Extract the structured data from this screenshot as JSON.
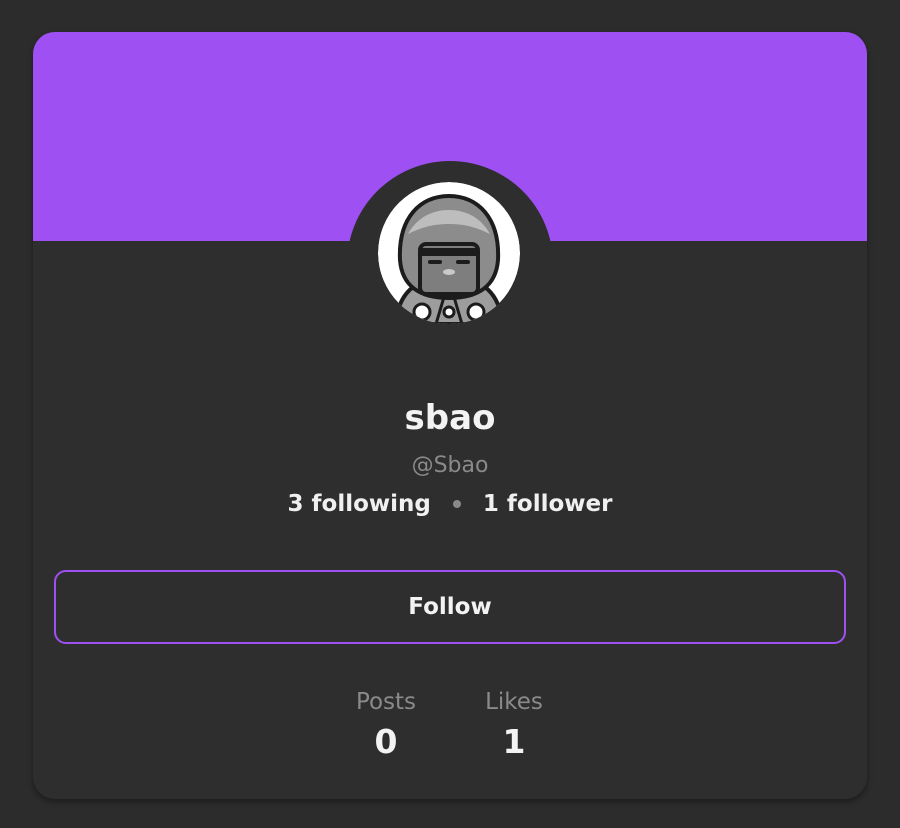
{
  "profile": {
    "display_name": "sbao",
    "handle": "@Sbao",
    "following": "3 following",
    "followers": "1 follower",
    "follow_label": "Follow"
  },
  "counts": [
    {
      "label": "Posts",
      "value": "0"
    },
    {
      "label": "Likes",
      "value": "1"
    }
  ],
  "colors": {
    "accent": "#9e50f2",
    "background": "#2b2c2b",
    "card": "#2d2e2d",
    "text": "#f3f3f3",
    "muted": "#8a8a8a"
  },
  "icons": {
    "avatar": "hooded-character-avatar"
  }
}
